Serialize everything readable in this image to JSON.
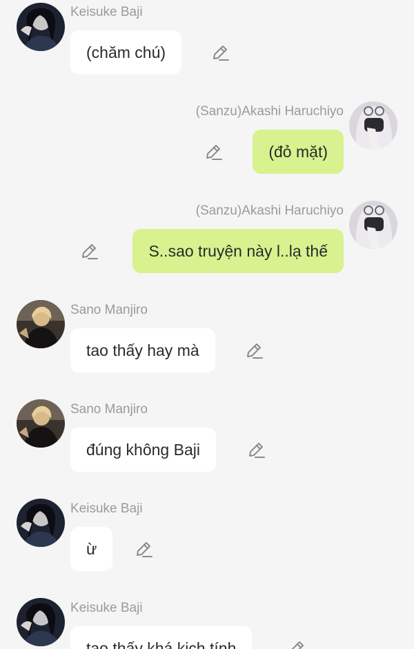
{
  "messages": [
    {
      "side": "left",
      "sender": "Keisuke Baji",
      "avatar": "baji-avatar",
      "text": "(chăm chú)"
    },
    {
      "side": "right",
      "sender": "(Sanzu)Akashi Haruchiyo",
      "avatar": "sanzu-avatar",
      "text": "(đỏ mặt)"
    },
    {
      "side": "right",
      "sender": "(Sanzu)Akashi Haruchiyo",
      "avatar": "sanzu-avatar",
      "text": "S..sao truyện này l..lạ thế"
    },
    {
      "side": "left",
      "sender": "Sano Manjiro",
      "avatar": "mikey-avatar",
      "text": "tao thấy hay mà"
    },
    {
      "side": "left",
      "sender": "Sano Manjiro",
      "avatar": "mikey-avatar",
      "text": "đúng không Baji"
    },
    {
      "side": "left",
      "sender": "Keisuke Baji",
      "avatar": "baji-avatar",
      "text": "ừ"
    },
    {
      "side": "left",
      "sender": "Keisuke Baji",
      "avatar": "baji-avatar",
      "text": "tao thấy khá kịch tính"
    }
  ],
  "colors": {
    "background": "#f5f5f5",
    "bubble_left": "#ffffff",
    "bubble_right": "#d7f28f",
    "name_text": "#9a9a9a",
    "message_text": "#2a2a2a",
    "edit_icon": "#8a8a8a"
  },
  "icons": {
    "edit": "pencil-edit-icon"
  }
}
